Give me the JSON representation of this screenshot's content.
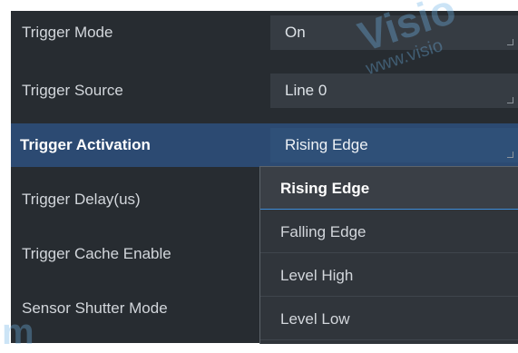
{
  "rows": [
    {
      "label": "Trigger Mode",
      "value": "On"
    },
    {
      "label": "Trigger Source",
      "value": "Line 0"
    },
    {
      "label": "Trigger Activation",
      "value": "Rising Edge"
    },
    {
      "label": "Trigger Delay(us)",
      "value": ""
    },
    {
      "label": "Trigger Cache Enable",
      "value": ""
    },
    {
      "label": "Sensor Shutter Mode",
      "value": ""
    }
  ],
  "dropdown": {
    "options": [
      "Rising Edge",
      "Falling Edge",
      "Level High",
      "Level Low"
    ],
    "selected": "Rising Edge"
  },
  "colors": {
    "panel_bg": "#272c31",
    "value_bg": "#363c43",
    "active_row": "#2c4a72",
    "focus_line": "#3d8cd9"
  },
  "watermarks": [
    "Visio",
    "www.visio",
    "m"
  ]
}
